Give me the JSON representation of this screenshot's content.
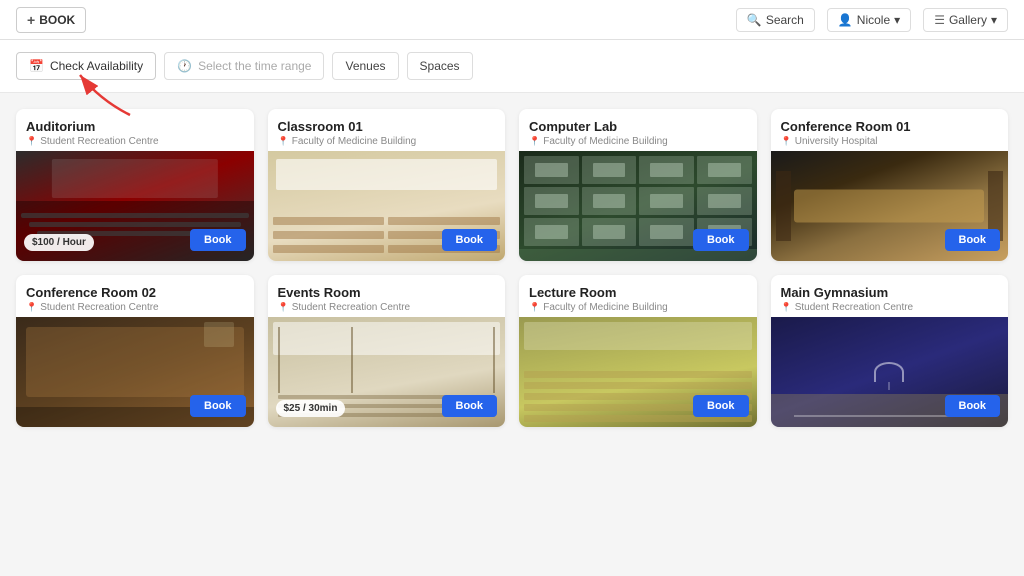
{
  "header": {
    "book_label": "BOOK",
    "search_label": "Search",
    "user_label": "Nicole",
    "gallery_label": "Gallery"
  },
  "toolbar": {
    "check_availability_label": "Check Availability",
    "time_range_placeholder": "Select the time range",
    "venues_label": "Venues",
    "spaces_label": "Spaces"
  },
  "rooms": [
    {
      "id": "auditorium",
      "title": "Auditorium",
      "location": "Student Recreation Centre",
      "price": "$100 / Hour",
      "img_class": "img-auditorium",
      "book_label": "Book"
    },
    {
      "id": "classroom01",
      "title": "Classroom 01",
      "location": "Faculty of Medicine Building",
      "price": null,
      "img_class": "img-classroom",
      "book_label": "Book"
    },
    {
      "id": "computer-lab",
      "title": "Computer Lab",
      "location": "Faculty of Medicine Building",
      "price": null,
      "img_class": "img-computer-lab",
      "book_label": "Book"
    },
    {
      "id": "conference-room-01",
      "title": "Conference Room 01",
      "location": "University Hospital",
      "price": null,
      "img_class": "img-conf01",
      "book_label": "Book"
    },
    {
      "id": "conference-room-02",
      "title": "Conference Room 02",
      "location": "Student Recreation Centre",
      "price": null,
      "img_class": "img-conf02",
      "book_label": "Book"
    },
    {
      "id": "events-room",
      "title": "Events Room",
      "location": "Student Recreation Centre",
      "price": "$25 / 30min",
      "img_class": "img-events",
      "book_label": "Book"
    },
    {
      "id": "lecture-room",
      "title": "Lecture Room",
      "location": "Faculty of Medicine Building",
      "price": null,
      "img_class": "img-lecture",
      "book_label": "Book"
    },
    {
      "id": "main-gymnasium",
      "title": "Main Gymnasium",
      "location": "Student Recreation Centre",
      "price": null,
      "img_class": "img-gymnasium",
      "book_label": "Book"
    }
  ]
}
